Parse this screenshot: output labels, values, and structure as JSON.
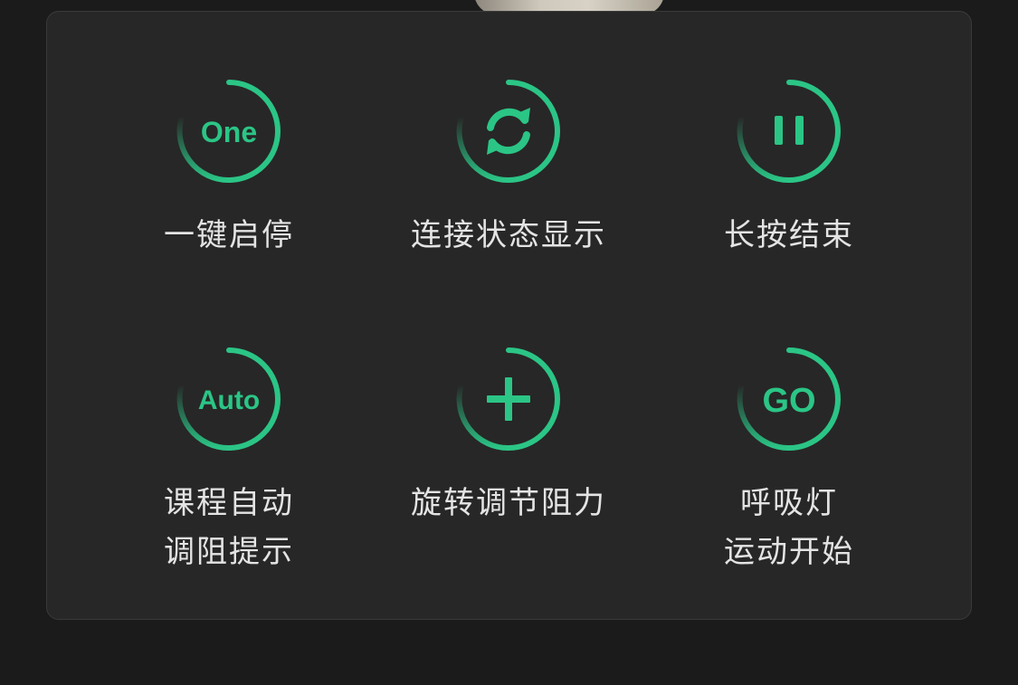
{
  "colors": {
    "page_background": "#1b1b1b",
    "panel_background": "#272727",
    "accent": "#2bc586",
    "label_text": "#e4e4e4"
  },
  "features": [
    {
      "icon": "one-text-icon",
      "glyph": "One",
      "label_lines": [
        "一键启停"
      ]
    },
    {
      "icon": "refresh-icon",
      "glyph": "",
      "label_lines": [
        "连接状态显示"
      ]
    },
    {
      "icon": "pause-icon",
      "glyph": "",
      "label_lines": [
        "长按结束"
      ]
    },
    {
      "icon": "auto-text-icon",
      "glyph": "Auto",
      "label_lines": [
        "课程自动",
        "调阻提示"
      ]
    },
    {
      "icon": "plus-icon",
      "glyph": "",
      "label_lines": [
        "旋转调节阻力"
      ]
    },
    {
      "icon": "go-text-icon",
      "glyph": "GO",
      "label_lines": [
        "呼吸灯",
        "运动开始"
      ]
    }
  ]
}
